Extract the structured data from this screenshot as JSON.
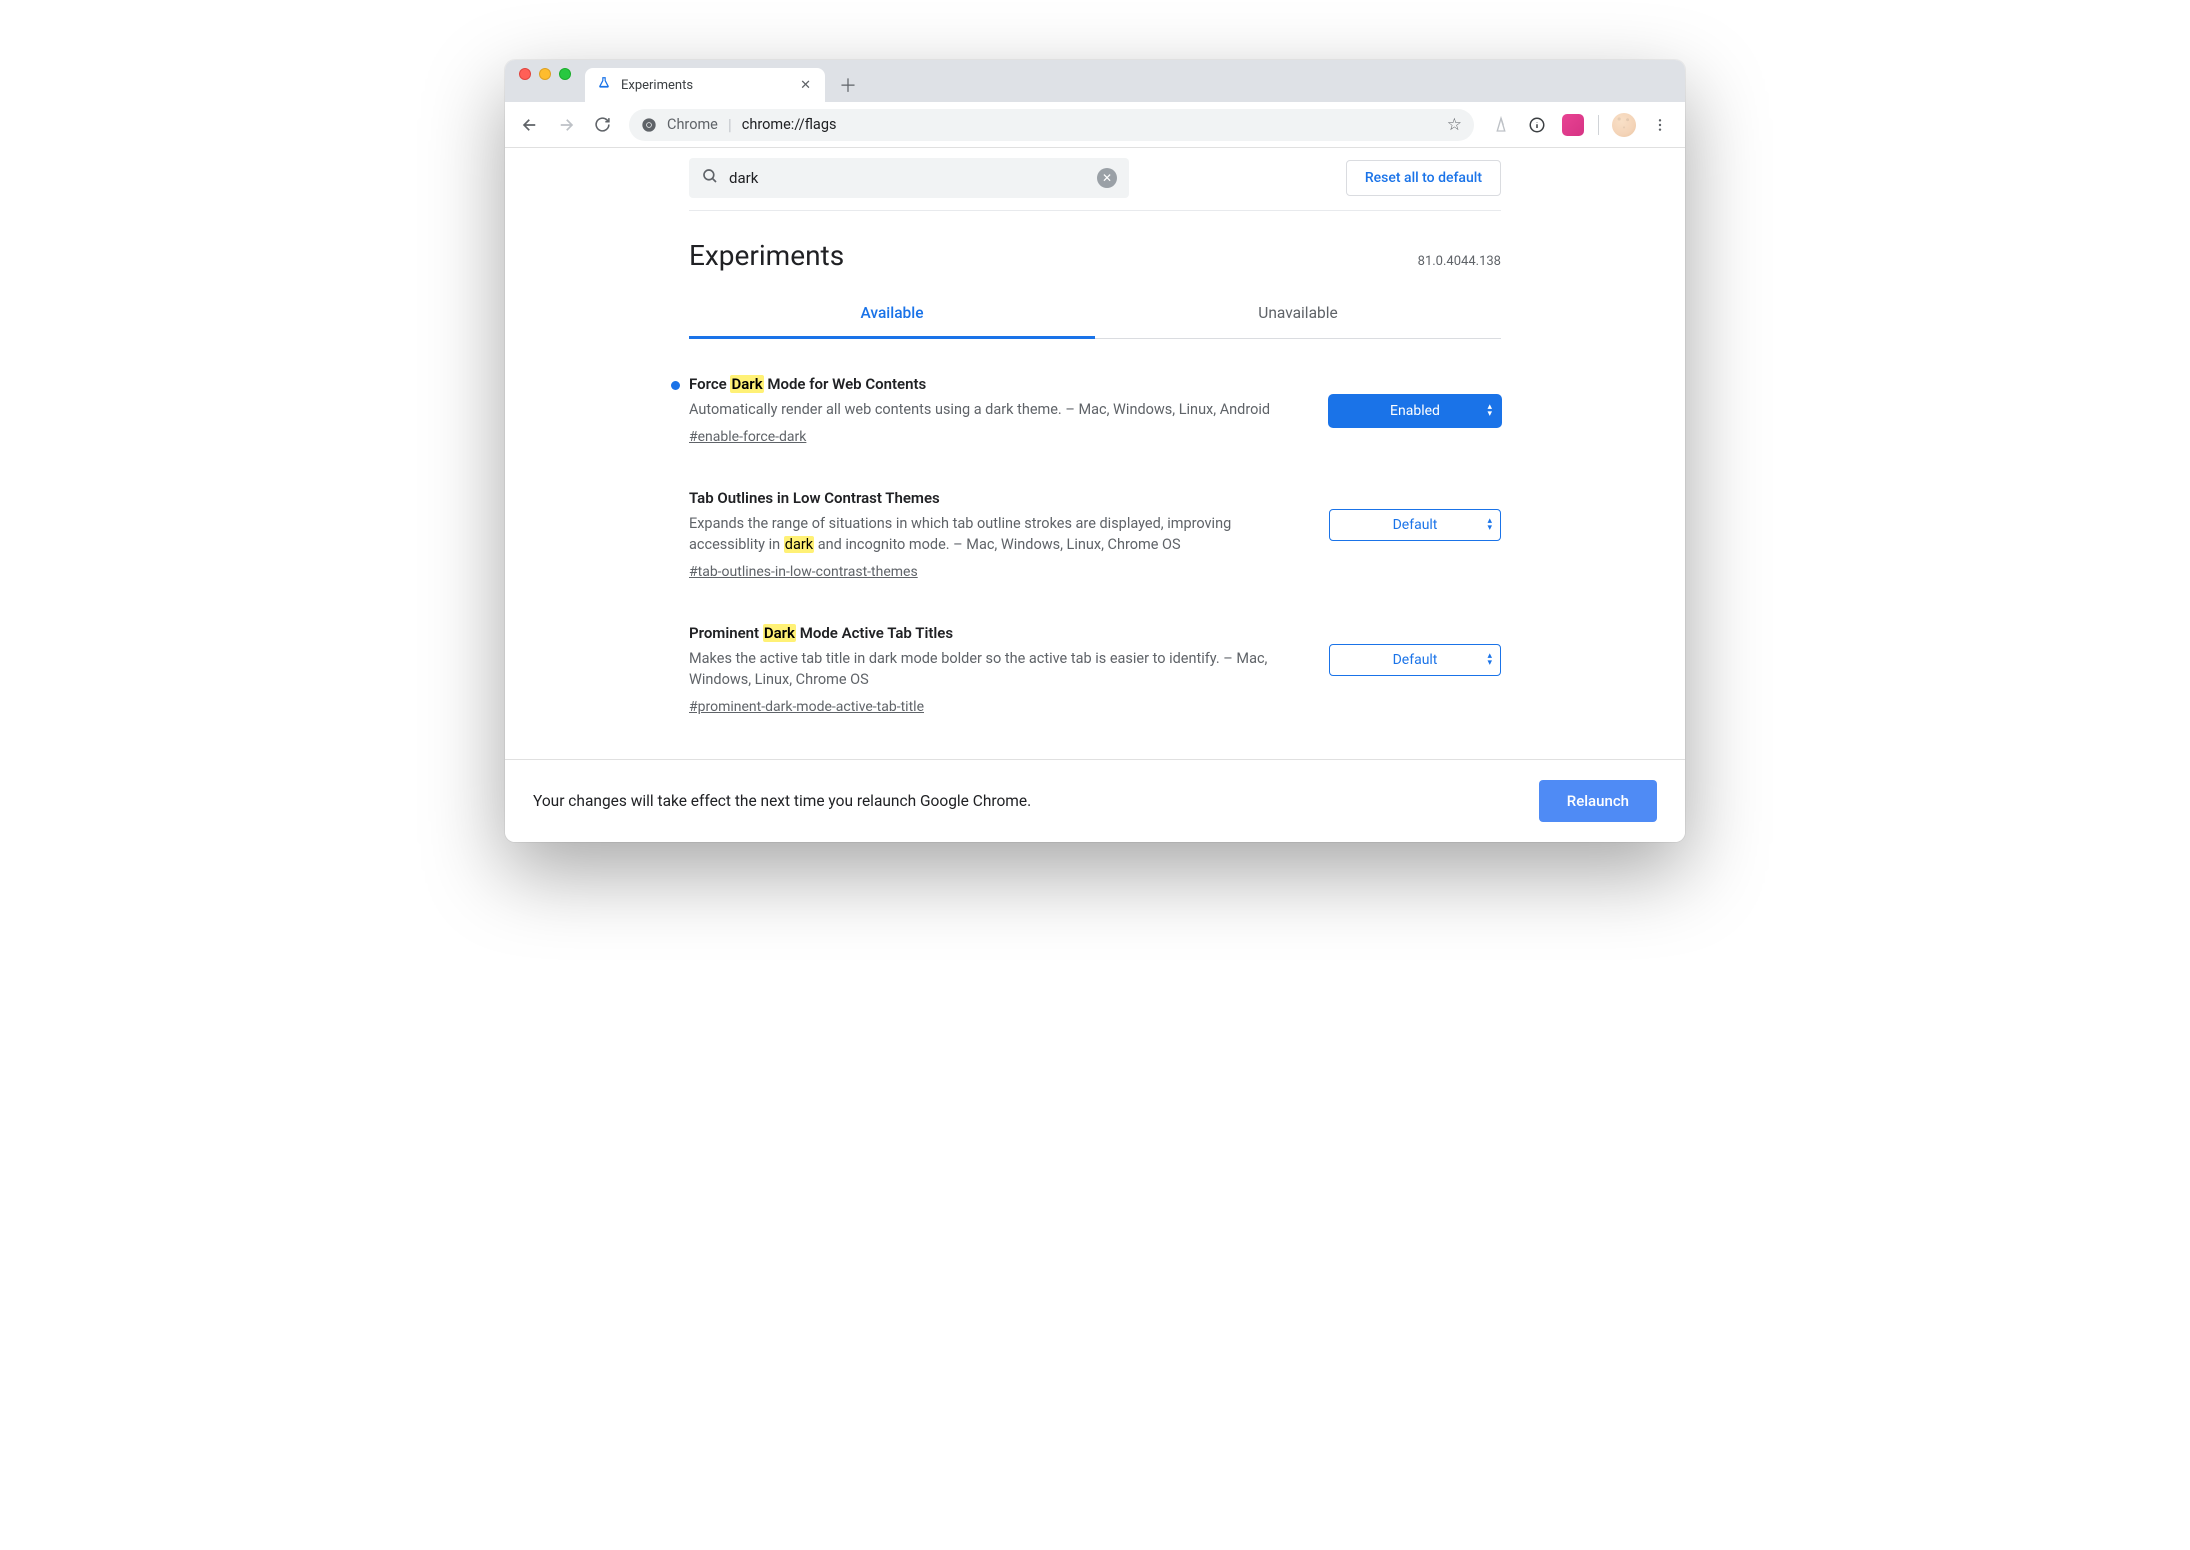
{
  "browser": {
    "tab_title": "Experiments",
    "omnibox": {
      "origin": "Chrome",
      "path": "chrome://flags"
    }
  },
  "topstrip": {
    "search_value": "dark",
    "reset_label": "Reset all to default"
  },
  "header": {
    "title": "Experiments",
    "version": "81.0.4044.138"
  },
  "tabs": {
    "available": "Available",
    "unavailable": "Unavailable"
  },
  "flags": [
    {
      "modified": true,
      "title_pre": "Force ",
      "title_hl": "Dark",
      "title_post": " Mode for Web Contents",
      "desc_pre": "Automatically render all web contents using a dark theme. – Mac, Windows, Linux, Android",
      "desc_hl": "",
      "desc_post": "",
      "link": "#enable-force-dark",
      "select_value": "Enabled",
      "select_variant": "enabled"
    },
    {
      "modified": false,
      "title_pre": "Tab Outlines in Low Contrast Themes",
      "title_hl": "",
      "title_post": "",
      "desc_pre": "Expands the range of situations in which tab outline strokes are displayed, improving accessiblity in ",
      "desc_hl": "dark",
      "desc_post": " and incognito mode. – Mac, Windows, Linux, Chrome OS",
      "link": "#tab-outlines-in-low-contrast-themes",
      "select_value": "Default",
      "select_variant": "default"
    },
    {
      "modified": false,
      "title_pre": "Prominent ",
      "title_hl": "Dark",
      "title_post": " Mode Active Tab Titles",
      "desc_pre": "Makes the active tab title in dark mode bolder so the active tab is easier to identify. – Mac, Windows, Linux, Chrome OS",
      "desc_hl": "",
      "desc_post": "",
      "link": "#prominent-dark-mode-active-tab-title",
      "select_value": "Default",
      "select_variant": "default"
    }
  ],
  "footer": {
    "message": "Your changes will take effect the next time you relaunch Google Chrome.",
    "relaunch_label": "Relaunch"
  }
}
